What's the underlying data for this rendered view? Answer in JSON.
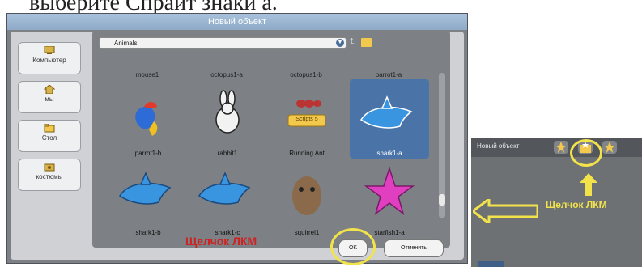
{
  "top_text": "выберите Спрайт знаки а.",
  "dialog": {
    "title": "Новый объект",
    "sidebar": [
      {
        "label": "Компьютер",
        "icon": "computer-icon"
      },
      {
        "label": "мы",
        "icon": "home-icon"
      },
      {
        "label": "Стол",
        "icon": "desktop-icon"
      },
      {
        "label": "костюмы",
        "icon": "costumes-icon"
      }
    ],
    "folder": "Animals",
    "top_row_labels": [
      "mouse1",
      "octopus1-a",
      "octopus1-b",
      "parrot1-a"
    ],
    "items": [
      {
        "name": "parrot1-b"
      },
      {
        "name": "rabbit1"
      },
      {
        "name": "Running Ant",
        "badge": "Scripts 5"
      },
      {
        "name": "shark1-a",
        "selected": true
      },
      {
        "name": "shark1-b"
      },
      {
        "name": "shark1-c"
      },
      {
        "name": "squirrel1"
      },
      {
        "name": "starfish1-a"
      }
    ],
    "ok_label": "OK",
    "cancel_label": "Отменить"
  },
  "annotations": {
    "click_left": "Щелчок ЛКМ",
    "click_right": "Щелчок ЛКМ"
  },
  "right_panel": {
    "label": "Новый объект"
  },
  "colors": {
    "selection": "#4a74a8",
    "annotation_red": "#d02020",
    "annotation_yellow": "#f2e34b"
  }
}
